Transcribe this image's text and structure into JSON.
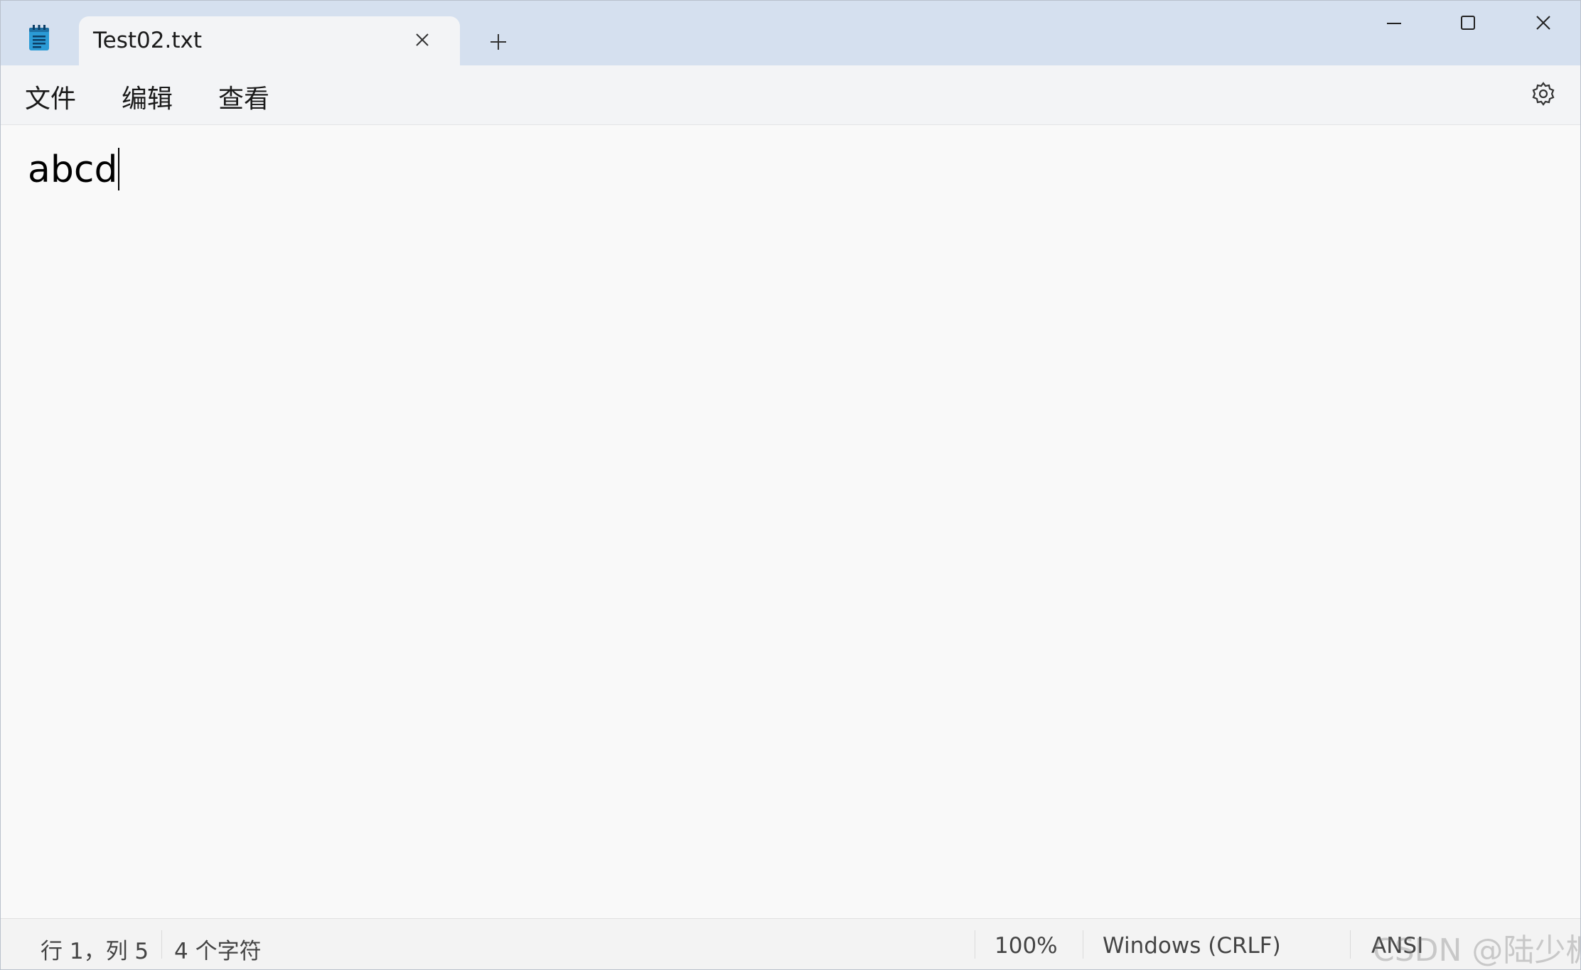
{
  "window": {
    "tab_title": "Test02.txt",
    "icons": {
      "app": "notepad-icon",
      "tab_close": "close-icon",
      "new_tab": "plus-icon",
      "minimize": "minimize-icon",
      "maximize": "maximize-icon",
      "close": "close-icon",
      "settings": "gear-icon"
    }
  },
  "menu": {
    "file": "文件",
    "edit": "编辑",
    "view": "查看"
  },
  "editor": {
    "content": "abcd"
  },
  "status": {
    "position": "行 1，列 5",
    "char_count": "4 个字符",
    "zoom": "100%",
    "line_ending": "Windows (CRLF)",
    "encoding": "ANSI"
  },
  "watermark": "CSDN @陆少枫",
  "colors": {
    "titlebar": "#d5e0ef",
    "tab": "#f3f4f6",
    "editor_bg": "#f9f9f9",
    "status_bg": "#f3f3f3"
  }
}
